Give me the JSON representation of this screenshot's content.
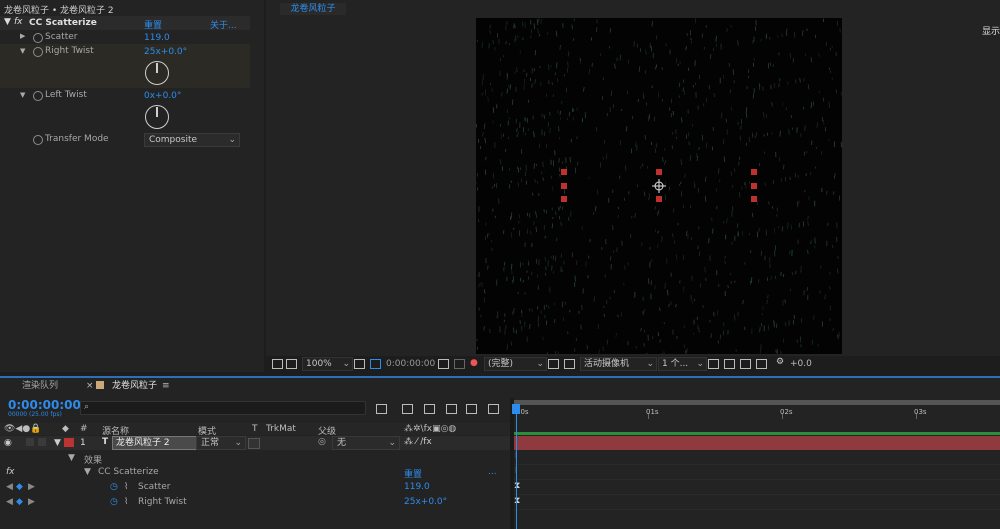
{
  "effect_controls": {
    "title": "龙卷风粒子 • 龙卷风粒子 2",
    "effect_name": "CC Scatterize",
    "reset_label": "重置",
    "about_label": "关于...",
    "properties": [
      {
        "name": "Scatter",
        "value": "119.0"
      },
      {
        "name": "Right Twist",
        "value": "25x+0.0°"
      },
      {
        "name": "Left Twist",
        "value": "0x+0.0°"
      },
      {
        "name": "Transfer Mode",
        "value": "Composite"
      }
    ]
  },
  "composition": {
    "tab_label": "龙卷风粒子",
    "right_label": "显示",
    "toolbar": {
      "zoom": "100%",
      "timecode": "0:00:00:00",
      "resolution": "(完整)",
      "camera": "活动摄像机",
      "views": "1 个...",
      "exposure": "+0.0"
    }
  },
  "timeline": {
    "tabs": [
      "渲染队列",
      "龙卷风粒子"
    ],
    "current_time": "0:00:00:00",
    "fps": "00000 (25.00 fps)",
    "search_placeholder": "",
    "headers": {
      "source_name": "源名称",
      "mode": "模式",
      "t": "T",
      "trkmat": "TrkMat",
      "parent": "父级"
    },
    "layer": {
      "index": "1",
      "type": "T",
      "name": "龙卷风粒子 2",
      "mode": "正常",
      "parent": "无"
    },
    "effects_group": "效果",
    "effect_name": "CC Scatterize",
    "reset_label": "重置",
    "more": "...",
    "props": [
      {
        "name": "Scatter",
        "value": "119.0"
      },
      {
        "name": "Right Twist",
        "value": "25x+0.0°"
      }
    ],
    "ruler_labels": [
      "00s",
      "01s",
      "02s",
      "03s"
    ],
    "track_colors": {
      "layer": "#8f3a3f",
      "work_area": "#2d8e3a",
      "playhead": "#2d8ceb"
    }
  }
}
